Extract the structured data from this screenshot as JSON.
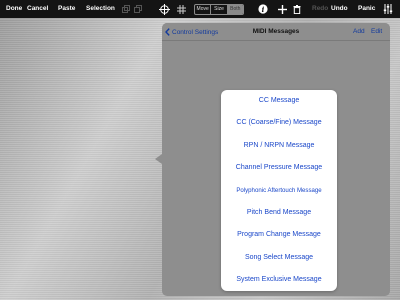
{
  "toolbar": {
    "done": "Done",
    "cancel": "Cancel",
    "paste": "Paste",
    "selection": "Selection",
    "segments": [
      "Move",
      "Size",
      "Both"
    ],
    "selected_segment": "Both",
    "redo": "Redo",
    "undo": "Undo",
    "panic": "Panic"
  },
  "panel": {
    "back_label": "Control Settings",
    "title": "MIDI Messages",
    "add_label": "Add",
    "edit_label": "Edit"
  },
  "menu": {
    "items": [
      "CC Message",
      "CC (Coarse/Fine) Message",
      "RPN / NRPN Message",
      "Channel Pressure Message",
      "Polyphonic Aftertouch Message",
      "Pitch Bend Message",
      "Program Change Message",
      "Song Select Message",
      "System Exclusive Message"
    ]
  },
  "colors": {
    "toolbar_bg": "#141414",
    "link_blue": "#1a47c9",
    "panel_bg": "#8e8e8e"
  }
}
